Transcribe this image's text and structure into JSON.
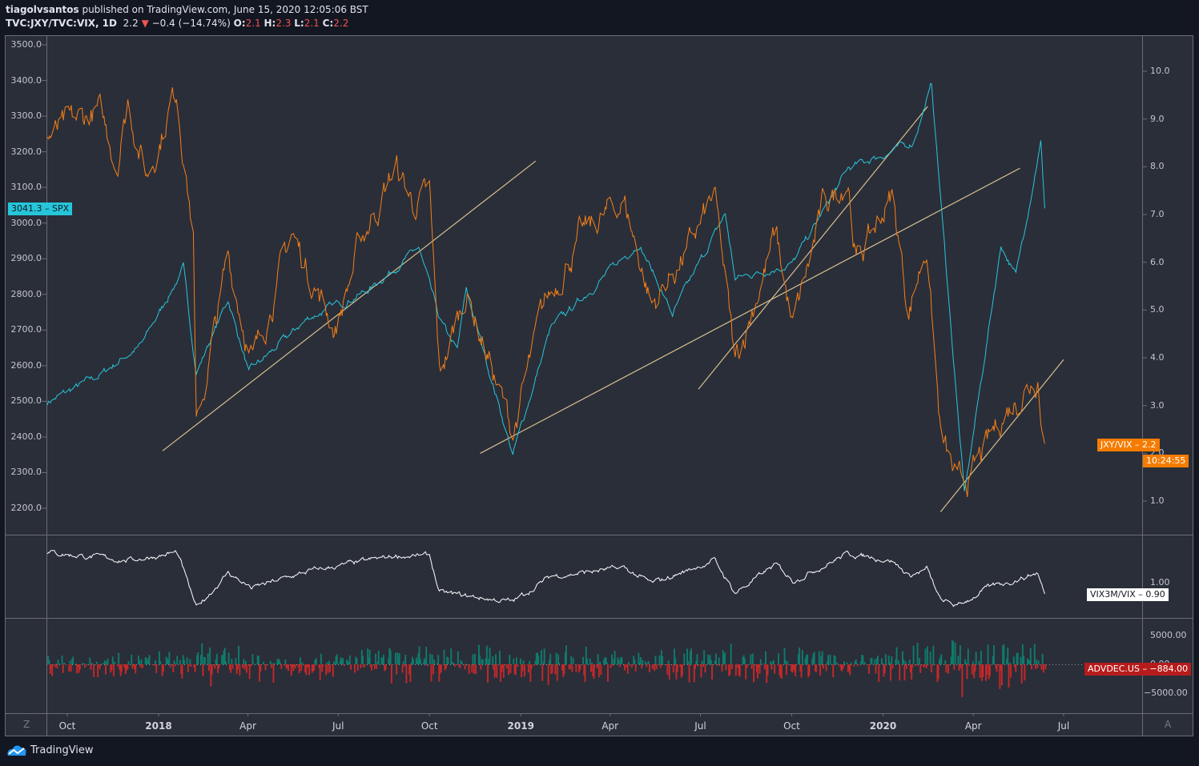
{
  "header": {
    "author": "tiagolvsantos",
    "published": "published on TradingView.com, June 15, 2020 12:05:06 BST",
    "symbol": "TVC:JXY/TVC:VIX, 1D",
    "last": "2.2",
    "change": "−0.4 (−14.74%)",
    "o_label": "O:",
    "o": "2.1",
    "h_label": "H:",
    "h": "2.3",
    "l_label": "L:",
    "l": "2.1",
    "c_label": "C:",
    "c": "2.2"
  },
  "axes": {
    "left_ticks": [
      "3500.0",
      "3400.0",
      "3300.0",
      "3200.0",
      "3100.0",
      "3000.0",
      "2900.0",
      "2800.0",
      "2700.0",
      "2600.0",
      "2500.0",
      "2400.0",
      "2300.0",
      "2200.0"
    ],
    "right_ticks": [
      "10.0",
      "9.0",
      "8.0",
      "7.0",
      "6.0",
      "5.0",
      "4.0",
      "3.0",
      "2.0",
      "1.0"
    ],
    "pane2_ticks": [
      "1.00"
    ],
    "pane3_ticks": [
      "5000.00",
      "0.00",
      "−5000.00"
    ],
    "time_ticks": [
      {
        "label": "Oct",
        "date": "2017-10-01",
        "year": false
      },
      {
        "label": "2018",
        "date": "2018-01-01",
        "year": true
      },
      {
        "label": "Apr",
        "date": "2018-04-01",
        "year": false
      },
      {
        "label": "Jul",
        "date": "2018-07-01",
        "year": false
      },
      {
        "label": "Oct",
        "date": "2018-10-01",
        "year": false
      },
      {
        "label": "2019",
        "date": "2019-01-01",
        "year": true
      },
      {
        "label": "Apr",
        "date": "2019-04-01",
        "year": false
      },
      {
        "label": "Jul",
        "date": "2019-07-01",
        "year": false
      },
      {
        "label": "Oct",
        "date": "2019-10-01",
        "year": false
      },
      {
        "label": "2020",
        "date": "2020-01-01",
        "year": true
      },
      {
        "label": "Apr",
        "date": "2020-04-01",
        "year": false
      },
      {
        "label": "Jul",
        "date": "2020-07-01",
        "year": false
      }
    ],
    "corner_left": "Z",
    "corner_right": "A"
  },
  "price_labels": {
    "spx_name": "SPX",
    "spx_value": "3041.3",
    "jxy_name": "JXY/VIX",
    "jxy_value": "2.2",
    "countdown": "10:24:55",
    "vix_name": "VIX3M/VIX",
    "vix_value": "0.90",
    "adv_name": "ADVDEC.US",
    "adv_value": "−884.00"
  },
  "footer": {
    "brand": "TradingView"
  },
  "chart_data": {
    "type": "line",
    "title": "TVC:JXY/TVC:VIX, 1D",
    "x_range": [
      "2017-09-11",
      "2020-06-12"
    ],
    "colors": {
      "spx": "#26c6da",
      "jxy": "#f57f17",
      "vix": "#ffffff",
      "adv_up": "#0f7b6c",
      "adv_down": "#c62828",
      "trendline": "#d6c08e"
    },
    "series": [
      {
        "name": "SPX",
        "axis": "left",
        "ylim": [
          2150,
          3530
        ],
        "points": [
          [
            "2017-09-11",
            2498
          ],
          [
            "2017-11-01",
            2570
          ],
          [
            "2017-12-15",
            2660
          ],
          [
            "2018-01-26",
            2872
          ],
          [
            "2018-02-08",
            2581
          ],
          [
            "2018-03-12",
            2786
          ],
          [
            "2018-04-02",
            2581
          ],
          [
            "2018-06-01",
            2734
          ],
          [
            "2018-08-01",
            2813
          ],
          [
            "2018-09-20",
            2930
          ],
          [
            "2018-10-11",
            2728
          ],
          [
            "2018-10-29",
            2641
          ],
          [
            "2018-11-07",
            2813
          ],
          [
            "2018-12-24",
            2351
          ],
          [
            "2019-01-31",
            2704
          ],
          [
            "2019-04-30",
            2945
          ],
          [
            "2019-06-03",
            2744
          ],
          [
            "2019-07-26",
            3025
          ],
          [
            "2019-08-05",
            2844
          ],
          [
            "2019-10-02",
            2887
          ],
          [
            "2019-11-27",
            3153
          ],
          [
            "2020-01-31",
            3225
          ],
          [
            "2020-02-19",
            3386
          ],
          [
            "2020-03-23",
            2237
          ],
          [
            "2020-04-29",
            2939
          ],
          [
            "2020-05-14",
            2852
          ],
          [
            "2020-06-08",
            3232
          ],
          [
            "2020-06-12",
            3041
          ]
        ]
      },
      {
        "name": "JXY/VIX",
        "axis": "right",
        "ylim": [
          0.3,
          10.55
        ],
        "points": [
          [
            "2017-09-11",
            8.6
          ],
          [
            "2017-11-01",
            9.15
          ],
          [
            "2017-11-20",
            8.1
          ],
          [
            "2017-12-01",
            9.4
          ],
          [
            "2017-12-20",
            7.8
          ],
          [
            "2018-01-19",
            9.65
          ],
          [
            "2018-02-05",
            6.6
          ],
          [
            "2018-02-08",
            2.44
          ],
          [
            "2018-03-12",
            6.1
          ],
          [
            "2018-04-06",
            3.9
          ],
          [
            "2018-05-15",
            6.6
          ],
          [
            "2018-06-28",
            4.6
          ],
          [
            "2018-07-25",
            6.5
          ],
          [
            "2018-08-28",
            8.0
          ],
          [
            "2018-09-15",
            7.2
          ],
          [
            "2018-10-01",
            7.4
          ],
          [
            "2018-10-11",
            3.6
          ],
          [
            "2018-11-07",
            5.4
          ],
          [
            "2018-12-24",
            2.44
          ],
          [
            "2019-01-25",
            5.1
          ],
          [
            "2019-03-01",
            6.5
          ],
          [
            "2019-04-15",
            7.3
          ],
          [
            "2019-05-13",
            5.1
          ],
          [
            "2019-06-20",
            6.3
          ],
          [
            "2019-07-15",
            7.4
          ],
          [
            "2019-08-05",
            3.9
          ],
          [
            "2019-09-15",
            6.6
          ],
          [
            "2019-10-02",
            4.6
          ],
          [
            "2019-11-01",
            7.1
          ],
          [
            "2019-11-27",
            7.8
          ],
          [
            "2019-12-05",
            6.0
          ],
          [
            "2020-01-10",
            7.4
          ],
          [
            "2020-01-27",
            5.0
          ],
          [
            "2020-02-14",
            6.4
          ],
          [
            "2020-02-28",
            2.36
          ],
          [
            "2020-03-16",
            1.27
          ],
          [
            "2020-04-01",
            1.6
          ],
          [
            "2020-05-01",
            2.8
          ],
          [
            "2020-06-05",
            3.7
          ],
          [
            "2020-06-10",
            2.4
          ],
          [
            "2020-06-12",
            2.2
          ]
        ]
      },
      {
        "name": "VIX3M/VIX",
        "axis": "pane2",
        "points": [
          [
            "2017-09-11",
            1.27
          ],
          [
            "2017-12-01",
            1.2
          ],
          [
            "2018-01-20",
            1.27
          ],
          [
            "2018-02-08",
            0.77
          ],
          [
            "2018-03-12",
            1.09
          ],
          [
            "2018-04-05",
            0.95
          ],
          [
            "2018-06-01",
            1.1
          ],
          [
            "2018-08-28",
            1.24
          ],
          [
            "2018-10-01",
            1.24
          ],
          [
            "2018-10-11",
            0.91
          ],
          [
            "2018-12-24",
            0.83
          ],
          [
            "2019-02-01",
            1.06
          ],
          [
            "2019-04-15",
            1.13
          ],
          [
            "2019-05-13",
            0.99
          ],
          [
            "2019-07-15",
            1.2
          ],
          [
            "2019-08-05",
            0.91
          ],
          [
            "2019-09-15",
            1.16
          ],
          [
            "2019-10-02",
            1.02
          ],
          [
            "2019-11-27",
            1.26
          ],
          [
            "2020-01-10",
            1.2
          ],
          [
            "2020-01-27",
            1.06
          ],
          [
            "2020-02-14",
            1.12
          ],
          [
            "2020-02-28",
            0.84
          ],
          [
            "2020-03-16",
            0.79
          ],
          [
            "2020-04-15",
            0.95
          ],
          [
            "2020-06-05",
            1.09
          ],
          [
            "2020-06-12",
            0.9
          ]
        ]
      },
      {
        "name": "ADVDEC.US",
        "axis": "pane3",
        "type": "histogram",
        "amplitude_envelope": [
          [
            "2017-09-11",
            2800
          ],
          [
            "2018-01-20",
            3200
          ],
          [
            "2018-02-08",
            5000
          ],
          [
            "2018-06-01",
            3300
          ],
          [
            "2018-10-15",
            4500
          ],
          [
            "2018-12-24",
            4800
          ],
          [
            "2019-05-01",
            3800
          ],
          [
            "2019-08-05",
            4800
          ],
          [
            "2019-12-01",
            3000
          ],
          [
            "2020-02-28",
            5500
          ],
          [
            "2020-03-20",
            6800
          ],
          [
            "2020-06-01",
            5200
          ],
          [
            "2020-06-12",
            5200
          ]
        ],
        "last": -884
      }
    ],
    "trendlines": [
      {
        "from": [
          "2018-01-05",
          2361
        ],
        "to": [
          "2019-01-16",
          3174
        ]
      },
      {
        "from": [
          "2018-11-21",
          2354
        ],
        "to": [
          "2020-05-18",
          3154
        ]
      },
      {
        "from": [
          "2019-06-29",
          2534
        ],
        "to": [
          "2020-02-15",
          3327
        ]
      },
      {
        "from": [
          "2020-02-28",
          2190
        ],
        "to": [
          "2020-07-01",
          2617
        ]
      }
    ]
  }
}
